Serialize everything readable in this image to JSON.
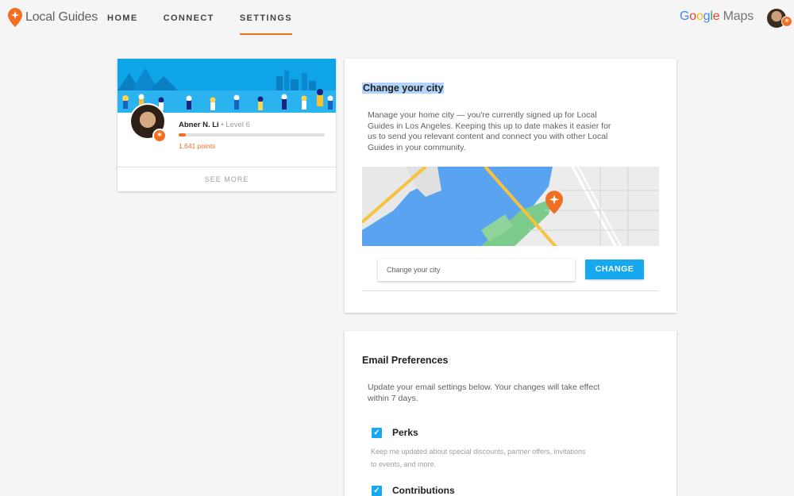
{
  "header": {
    "logo_text": "Local Guides",
    "nav": [
      {
        "label": "HOME",
        "active": false
      },
      {
        "label": "CONNECT",
        "active": false
      },
      {
        "label": "SETTINGS",
        "active": true
      }
    ],
    "google_maps": {
      "g1": "G",
      "g2": "o",
      "g3": "o",
      "g4": "g",
      "g5": "l",
      "g6": "e",
      "maps": " Maps"
    },
    "accent_color": "#f26f21"
  },
  "profile": {
    "name": "Abner N. Li",
    "level": " • Level 6",
    "points": "1,641 points",
    "progress": 0.05,
    "see_more": "SEE MORE",
    "badge_icon": "star-badge-icon"
  },
  "city": {
    "title": "Change your city",
    "description": "Manage your home city — you're currently signed up for Local Guides in Los Angeles. Keeping this up to date makes it easier for us to send you relevant content and connect you with other Local Guides in your community.",
    "input_placeholder": "Change your city",
    "change_button": "CHANGE",
    "button_color": "#16a9f0"
  },
  "email": {
    "title": "Email Preferences",
    "description": "Update your email settings below. Your changes will take effect within 7 days.",
    "prefs": [
      {
        "label": "Perks",
        "checked": true,
        "desc": "Keep me updated about special discounts, partner offers, invitations to events, and more."
      },
      {
        "label": "Contributions",
        "checked": true,
        "desc": ""
      }
    ]
  }
}
